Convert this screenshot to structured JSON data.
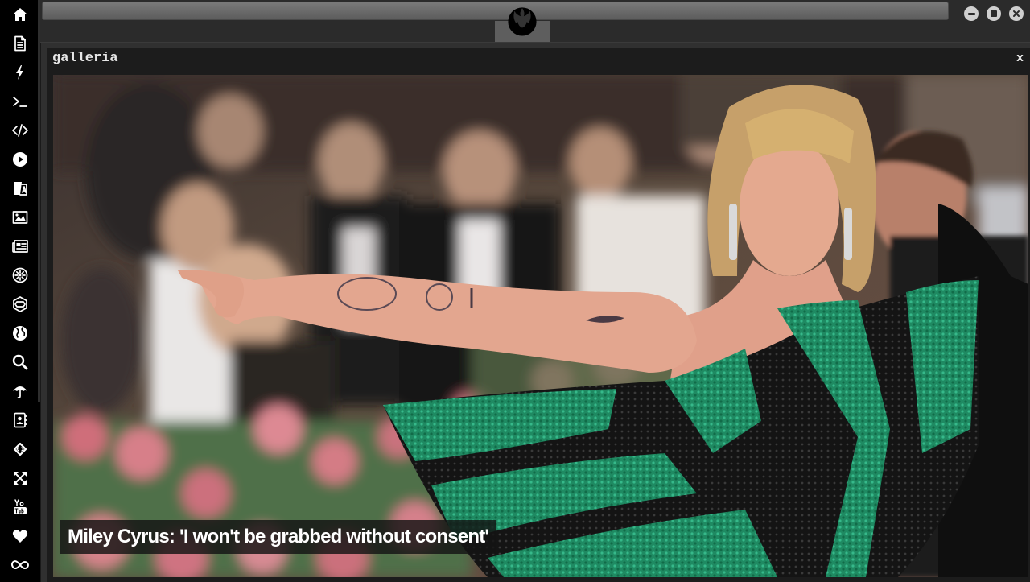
{
  "sidebar": {
    "items": [
      {
        "icon": "home-icon"
      },
      {
        "icon": "document-icon"
      },
      {
        "icon": "lightning-icon"
      },
      {
        "icon": "terminal-icon"
      },
      {
        "icon": "code-icon"
      },
      {
        "icon": "play-icon"
      },
      {
        "icon": "translate-icon"
      },
      {
        "icon": "image-icon"
      },
      {
        "icon": "newspaper-icon"
      },
      {
        "icon": "film-reel-icon"
      },
      {
        "icon": "hexagon-icon"
      },
      {
        "icon": "globe-icon"
      },
      {
        "icon": "search-icon"
      },
      {
        "icon": "umbrella-icon"
      },
      {
        "icon": "contact-book-icon"
      },
      {
        "icon": "diamond-arrows-icon"
      },
      {
        "icon": "expand-icon"
      },
      {
        "icon": "youtube-icon"
      },
      {
        "icon": "heart-icon"
      },
      {
        "icon": "infinity-icon"
      }
    ]
  },
  "topbar": {
    "logo_icon": "rebel-alliance-icon",
    "buttons": [
      "minimize-icon",
      "maximize-icon",
      "close-icon"
    ]
  },
  "panel": {
    "title": "galleria",
    "close_label": "x",
    "caption": "Miley Cyrus: 'I won't be grabbed without consent'"
  },
  "colors": {
    "background": "#303030",
    "sidebar": "#000000",
    "panel": "#1c1c1c",
    "dress_green": "#1f8a62"
  }
}
